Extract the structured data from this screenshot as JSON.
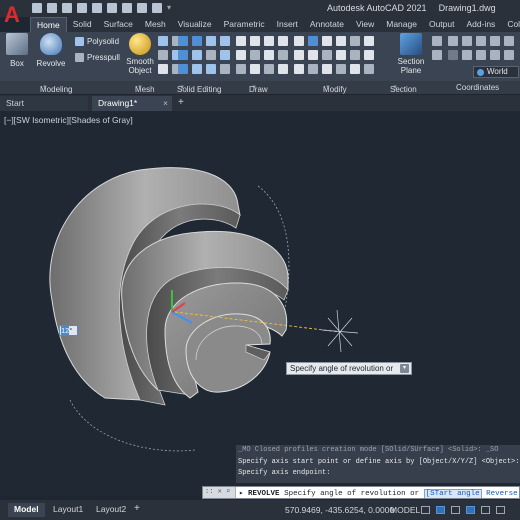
{
  "app": {
    "title": "Autodesk AutoCAD 2021",
    "document": "Drawing1.dwg",
    "logo": "A"
  },
  "ribbon": {
    "tabs": [
      "Home",
      "Solid",
      "Surface",
      "Mesh",
      "Visualize",
      "Parametric",
      "Insert",
      "Annotate",
      "View",
      "Manage",
      "Output",
      "Add-ins",
      "Collaborate"
    ],
    "active_tab": "Home",
    "buttons": {
      "box": "Box",
      "revolve": "Revolve",
      "polysolid": "Polysolid",
      "presspull": "Presspull",
      "smooth_object_line1": "Smooth",
      "smooth_object_line2": "Object",
      "section_plane_line1": "Section",
      "section_plane_line2": "Plane",
      "world": "World"
    },
    "panels": [
      "Modeling",
      "Mesh",
      "Solid Editing",
      "Draw",
      "Modify",
      "Section",
      "Coordinates"
    ]
  },
  "file_tabs": {
    "start": "Start",
    "drawing": "Drawing1*",
    "new_tab": "+"
  },
  "viewport": {
    "label": "[−][SW Isometric][Shades of Gray]",
    "angle_input": "12",
    "angle_unit": "°",
    "tooltip": "Specify angle of revolution or"
  },
  "command": {
    "history": [
      "_MO Closed profiles creation mode [SOlid/SUrface] <Solid>: _SO",
      "Specify axis start point or define axis by [Object/X/Y/Z] <Object>:",
      "Specify axis endpoint:"
    ],
    "prompt_command": "REVOLVE",
    "prompt_text": "Specify angle of revolution or",
    "prompt_option1": "[STart angle",
    "prompt_option2": "Reverse"
  },
  "statusbar": {
    "layouts": [
      "Model",
      "Layout1",
      "Layout2"
    ],
    "add_layout": "+",
    "coordinates": "570.9469, -435.6254, 0.0000",
    "space": "MODEL"
  },
  "colors": {
    "accent": "#4d88c9",
    "background": "#1f2833",
    "logo": "#e0282e"
  }
}
